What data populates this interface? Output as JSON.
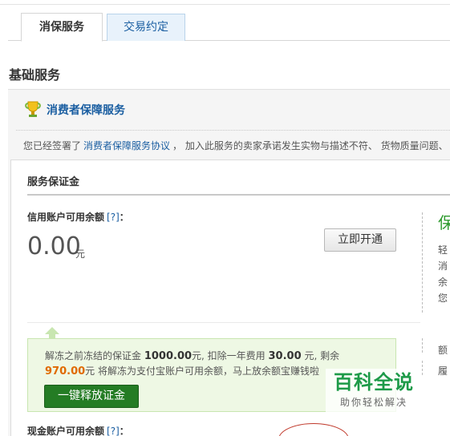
{
  "tabs": [
    {
      "label": "消保服务",
      "active": true
    },
    {
      "label": "交易约定",
      "active": false
    }
  ],
  "section_title": "基础服务",
  "service": {
    "icon": "trophy-icon",
    "name": "消费者保障服务",
    "agreement_prefix": "您已经签署了",
    "agreement_link": "消费者保障服务协议",
    "agreement_suffix": "， 加入此服务的卖家承诺发生实物与描述不符、 货物质量问题、"
  },
  "deposit": {
    "title": "服务保证金",
    "credit_label": "信用账户可用余额",
    "help": "[?]",
    "colon": "：",
    "amount": "0.00",
    "unit": "元",
    "open_button": "立即开通",
    "right_heading": "保",
    "right_lines": [
      "轻",
      "消",
      "余",
      "您"
    ],
    "right_lines_lower": [
      "额",
      "履"
    ]
  },
  "release": {
    "text_1": "解冻之前冻结的保证金 ",
    "frozen_amount": "1000.00",
    "text_2": "元, 扣除一年费用 ",
    "fee": "30.00",
    "text_3": " 元, 剩余",
    "remaining": "970.00",
    "text_4": "元 将解冻为支付宝账户可用余额，马上放余额宝赚钱啦",
    "button": "一键释放证金"
  },
  "cash": {
    "label": "现金账户可用余额",
    "help": "[?]",
    "colon": "："
  },
  "watermark": {
    "title": "百科全说",
    "subtitle": "助你轻松解决"
  },
  "colors": {
    "link": "#1a5ea1",
    "accent_green": "#247c24",
    "highlight_orange": "#e06a00"
  }
}
